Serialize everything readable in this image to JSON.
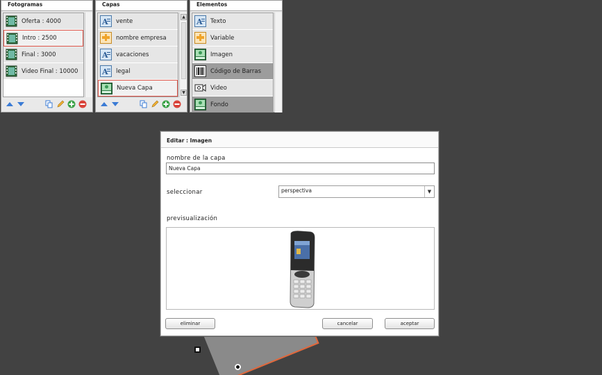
{
  "panels": {
    "fotogramas": {
      "title": "Fotogramas",
      "items": [
        {
          "label": "Oferta : 4000",
          "icon": "film-icon"
        },
        {
          "label": "Intro : 2500",
          "icon": "film-icon",
          "selected": true
        },
        {
          "label": "Final : 3000",
          "icon": "film-icon"
        },
        {
          "label": "Video Final : 10000",
          "icon": "film-icon"
        }
      ]
    },
    "capas": {
      "title": "Capas",
      "items": [
        {
          "label": "vente",
          "icon": "text-layer-icon"
        },
        {
          "label": "nombre empresa",
          "icon": "variable-icon"
        },
        {
          "label": "vacaciones",
          "icon": "text-layer-icon"
        },
        {
          "label": "legal",
          "icon": "text-layer-icon"
        },
        {
          "label": "Nueva Capa",
          "icon": "image-layer-icon",
          "selected": true
        }
      ]
    },
    "elementos": {
      "title": "Elementos",
      "items": [
        {
          "label": "Texto",
          "icon": "text-layer-icon"
        },
        {
          "label": "Variable",
          "icon": "variable-icon"
        },
        {
          "label": "Imagen",
          "icon": "image-layer-icon"
        },
        {
          "label": "Código de Barras",
          "icon": "barcode-icon",
          "dark": true
        },
        {
          "label": "Video",
          "icon": "video-icon"
        },
        {
          "label": "Fondo",
          "icon": "background-icon",
          "dark": true
        }
      ]
    }
  },
  "dialog": {
    "title": "Editar : Imagen",
    "layer_name_label": "nombre de la capa",
    "layer_name_value": "Nueva Capa",
    "select_label": "seleccionar",
    "select_value": "perspectiva",
    "preview_label": "previsualización",
    "delete_button": "eliminar",
    "cancel_button": "cancelar",
    "accept_button": "aceptar"
  },
  "colors": {
    "background": "#424242",
    "selection_border": "#e0564a",
    "accent_blue": "#3a7bd5",
    "add_green": "#3ea34a",
    "remove_red": "#d9433a"
  }
}
